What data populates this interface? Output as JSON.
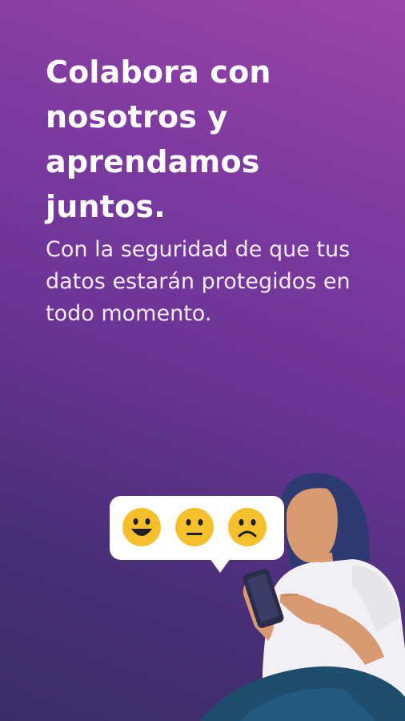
{
  "headline": "Colabora con nosotros y aprendamos juntos.",
  "subtext": "Con la seguridad de que tus datos estarán protegidos en todo momento.",
  "feedback_options": [
    {
      "icon": "happy-face-icon",
      "meaning": "satisfied"
    },
    {
      "icon": "neutral-face-icon",
      "meaning": "neutral"
    },
    {
      "icon": "sad-face-icon",
      "meaning": "unsatisfied"
    }
  ],
  "colors": {
    "background_top": "#9b45a9",
    "background_bottom": "#3a2d66",
    "emoji_yellow": "#f6c02c",
    "text": "#ffffff"
  }
}
